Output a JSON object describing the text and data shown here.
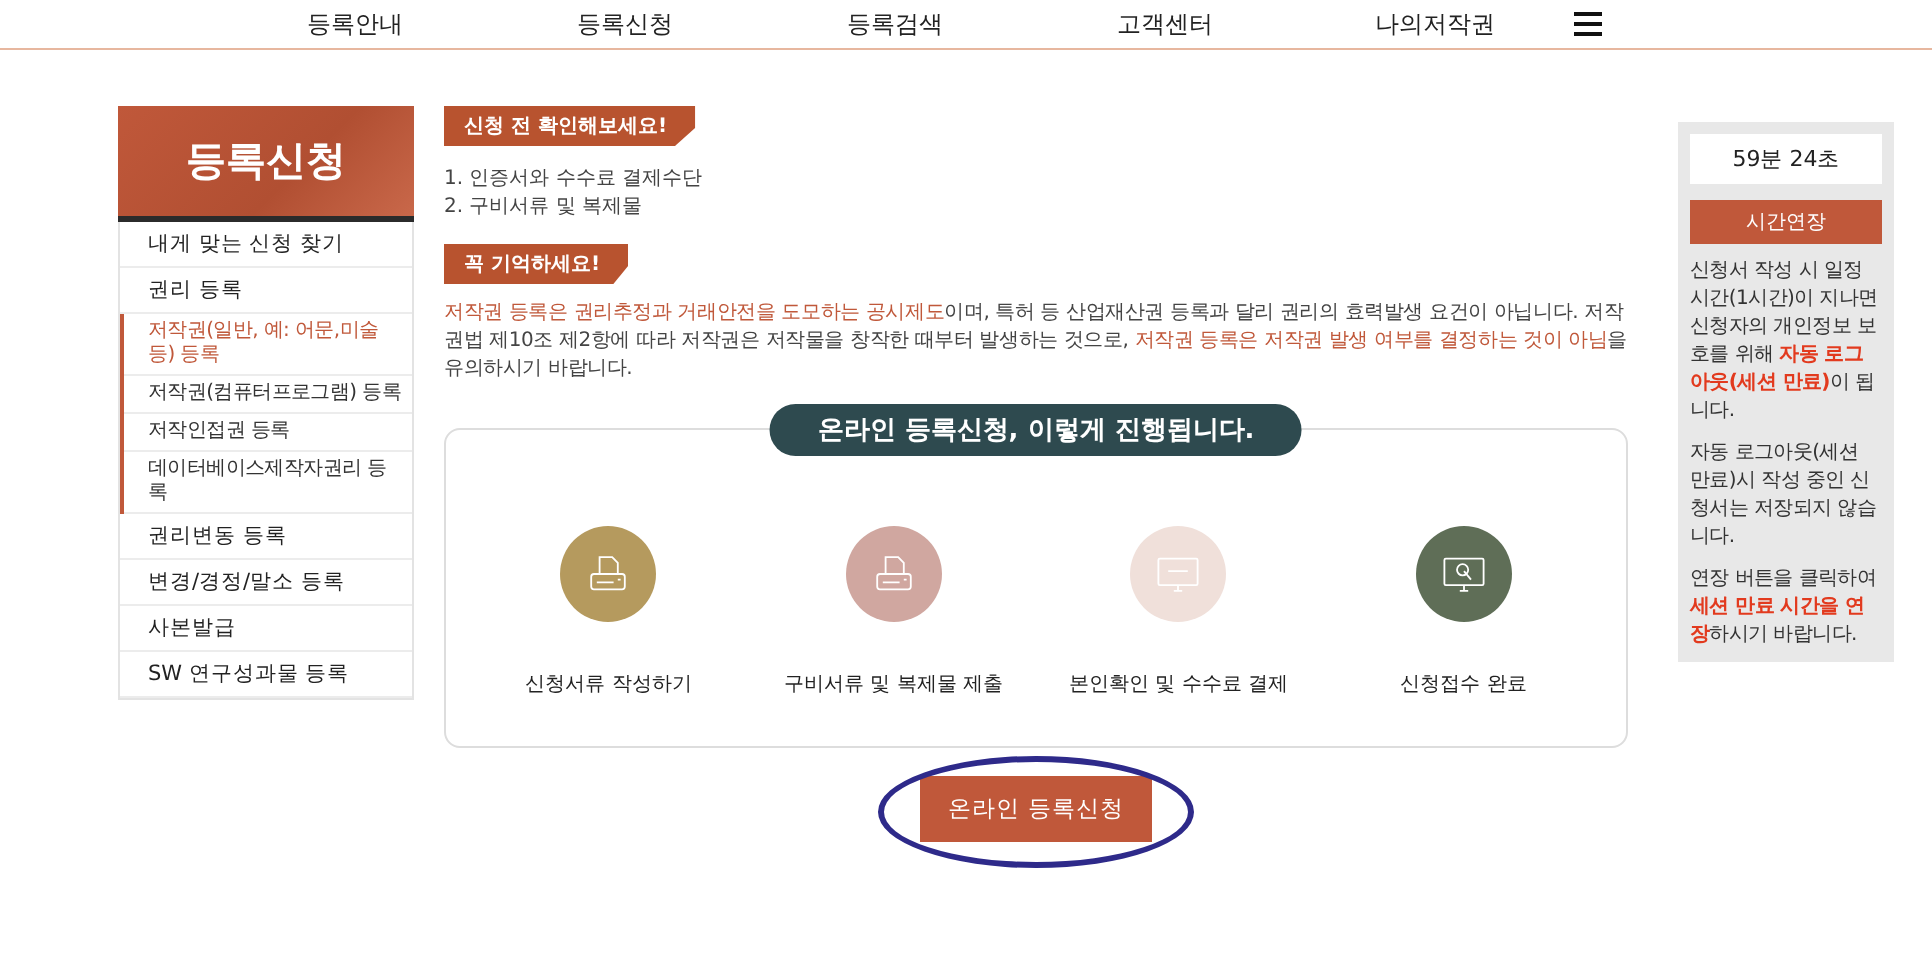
{
  "nav": {
    "items": [
      {
        "label": "등록안내"
      },
      {
        "label": "등록신청"
      },
      {
        "label": "등록검색"
      },
      {
        "label": "고객센터"
      },
      {
        "label": "나의저작권"
      }
    ]
  },
  "sidebar": {
    "title": "등록신청",
    "items": [
      {
        "label": "내게 맞는 신청 찾기"
      },
      {
        "label": "권리 등록",
        "children": [
          {
            "label": "저작권(일반, 예: 어문,미술 등) 등록",
            "selected": true
          },
          {
            "label": "저작권(컴퓨터프로그램) 등록",
            "selected": false
          },
          {
            "label": "저작인접권 등록",
            "selected": false
          },
          {
            "label": "데이터베이스제작자권리 등록",
            "selected": false
          }
        ]
      },
      {
        "label": "권리변동 등록"
      },
      {
        "label": "변경/경정/말소 등록"
      },
      {
        "label": "사본발급"
      },
      {
        "label": "SW 연구성과물 등록"
      }
    ]
  },
  "notice": {
    "badge": "신청 전 확인해보세요!",
    "items": [
      "1. 인증서와 수수료 결제수단",
      "2. 구비서류 및 복제물"
    ]
  },
  "remember": {
    "badge": "꼭 기억하세요!",
    "segments": [
      {
        "text": "저작권 등록은 권리추정과 거래안전을 도모하는 공시제도",
        "highlight": true
      },
      {
        "text": "이며, 특허 등 산업재산권 등록과 달리 권리의 효력발생 요건이 아닙니다. 저작권법 제10조 제2항에 따라 저작권은 저작물을 창작한 때부터 발생하는 것으로, ",
        "highlight": false
      },
      {
        "text": "저작권 등록은 저작권 발생 여부를 결정하는 것이 아님",
        "highlight": true
      },
      {
        "text": "을 유의하시기 바랍니다.",
        "highlight": false
      }
    ]
  },
  "process": {
    "title": "온라인 등록신청, 이렇게 진행됩니다.",
    "steps": [
      {
        "label": "신청서류 작성하기",
        "kind": "printer",
        "color": "#b59a5e"
      },
      {
        "label": "구비서류 및 복제물 제출",
        "kind": "printer",
        "color": "#d0a7a0"
      },
      {
        "label": "본인확인 및 수수료 결제",
        "kind": "monitor",
        "color": "#f0e0da"
      },
      {
        "label": "신청접수 완료",
        "kind": "touch",
        "color": "#5f6e57"
      }
    ]
  },
  "apply_button": {
    "label": "온라인 등록신청",
    "circled": true
  },
  "session": {
    "timer": "59분 24초",
    "button": "시간연장",
    "paragraphs": [
      [
        {
          "text": "신청서 작성 시 일정 시간(1시간)이 지나면 신청자의 개인정보 보호를 위해 ",
          "highlight": false
        },
        {
          "text": "자동 로그아웃(세션 만료)",
          "highlight": true
        },
        {
          "text": "이 됩니다.",
          "highlight": false
        }
      ],
      [
        {
          "text": "자동 로그아웃(세션 만료)시 작성 중인 신청서는 저장되지 않습니다.",
          "highlight": false
        }
      ],
      [
        {
          "text": "연장 버튼을 클릭하여 ",
          "highlight": false
        },
        {
          "text": "세션 만료 시간을 연장",
          "highlight": true
        },
        {
          "text": "하시기 바랍니다.",
          "highlight": false
        }
      ]
    ]
  }
}
